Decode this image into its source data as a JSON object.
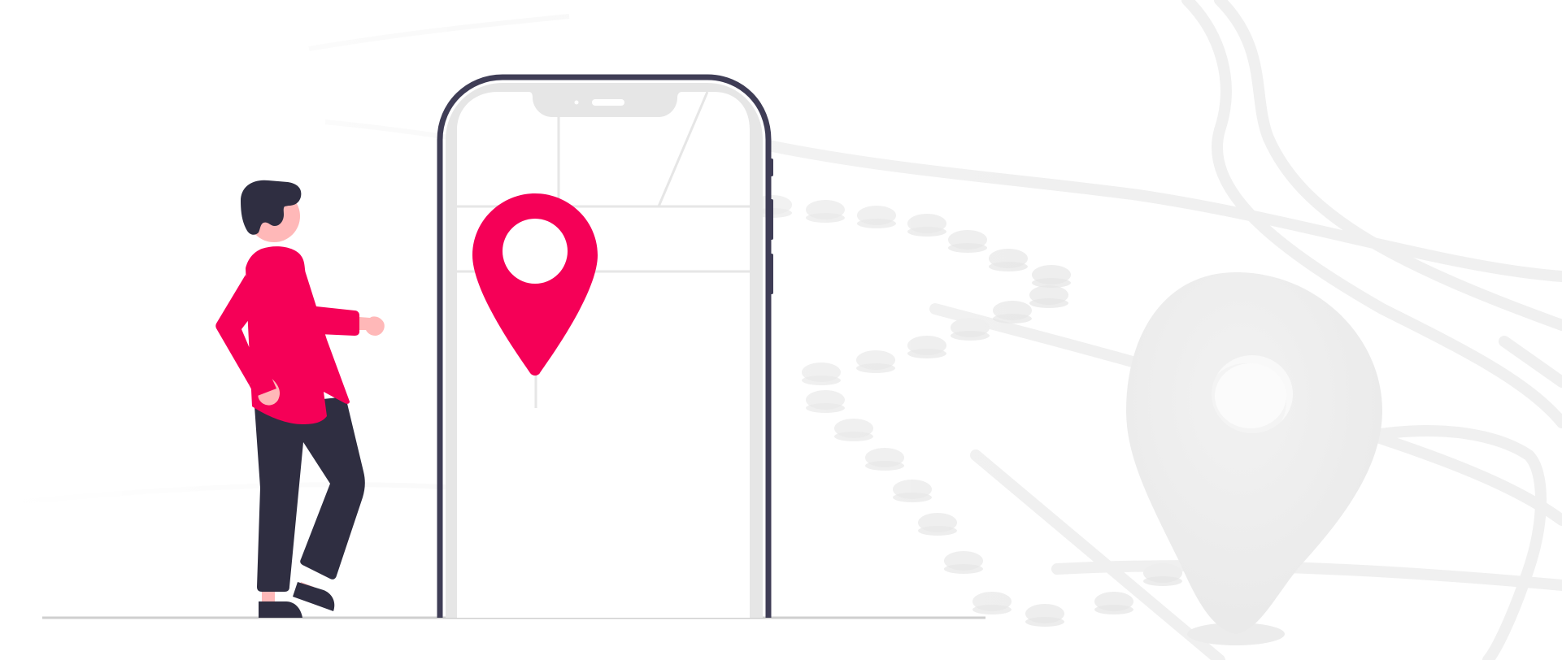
{
  "illustration": {
    "subject": "person-with-phone-location-pin",
    "icons": [
      "location-pin-icon",
      "map-pin-3d-icon"
    ]
  },
  "colors": {
    "accent": "#F50057",
    "outline": "#3F3D56",
    "hair_pants": "#2F2E41",
    "skin": "#FFB8B8",
    "phone_bezel": "#E6E6E6",
    "map_lines": "#E6E6E6",
    "ground": "#CFCFCF",
    "background_map": "#F4F4F4"
  }
}
